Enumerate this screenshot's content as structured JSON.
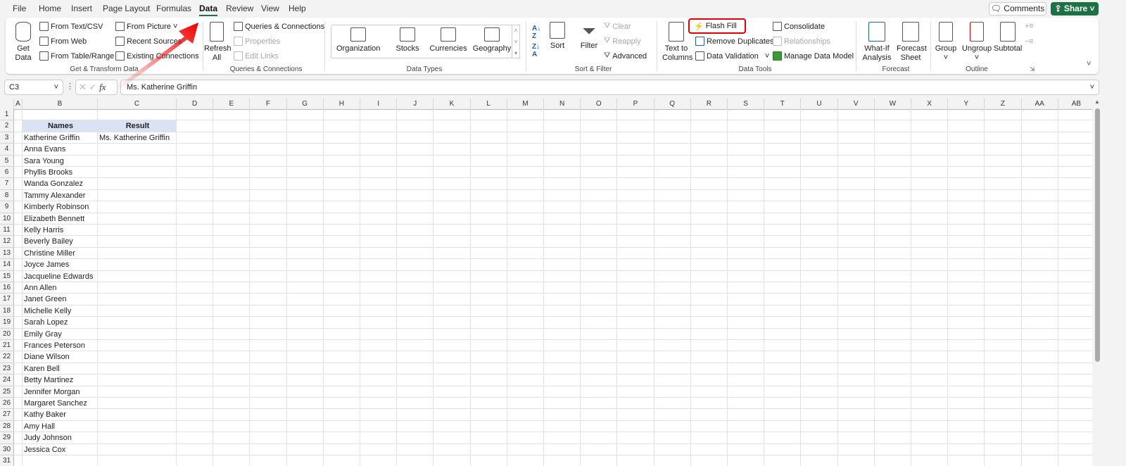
{
  "menu": {
    "tabs": [
      "File",
      "Home",
      "Insert",
      "Page Layout",
      "Formulas",
      "Data",
      "Review",
      "View",
      "Help"
    ],
    "active": "Data",
    "comments": "Comments",
    "share": "Share"
  },
  "ribbon": {
    "get_data": "Get Data",
    "get_transform": [
      "From Text/CSV",
      "From Web",
      "From Table/Range",
      "From Picture",
      "Recent Sources",
      "Existing Connections"
    ],
    "get_transform_label": "Get & Transform Data",
    "refresh": "Refresh All",
    "queries": [
      "Queries & Connections",
      "Properties",
      "Edit Links"
    ],
    "queries_label": "Queries & Connections",
    "data_types": [
      "Organization",
      "Stocks",
      "Currencies",
      "Geography"
    ],
    "data_types_label": "Data Types",
    "sort": "Sort",
    "filter": "Filter",
    "clear": "Clear",
    "reapply": "Reapply",
    "advanced": "Advanced",
    "sort_filter_label": "Sort & Filter",
    "text_to_columns": "Text to Columns",
    "tools": [
      "Flash Fill",
      "Remove Duplicates",
      "Data Validation",
      "Consolidate",
      "Relationships",
      "Manage Data Model"
    ],
    "data_tools_label": "Data Tools",
    "what_if": "What-If Analysis",
    "forecast_sheet": "Forecast Sheet",
    "forecast_label": "Forecast",
    "group": "Group",
    "ungroup": "Ungroup",
    "subtotal": "Subtotal",
    "outline_label": "Outline"
  },
  "formula_bar": {
    "name_box": "C3",
    "fx": "fx",
    "value": "Ms. Katherine Griffin"
  },
  "accent": "#1e7145",
  "highlight": "#e00000",
  "sheet": {
    "columns": [
      "A",
      "B",
      "C",
      "D",
      "E",
      "F",
      "G",
      "H",
      "I",
      "J",
      "K",
      "L",
      "M",
      "N",
      "O",
      "P",
      "Q",
      "R",
      "S",
      "T",
      "U",
      "V",
      "W",
      "X",
      "Y",
      "Z",
      "AA",
      "AB"
    ],
    "header_names": "Names",
    "header_result": "Result",
    "names": [
      "Katherine Griffin",
      "Anna Evans",
      "Sara Young",
      "Phyllis Brooks",
      "Wanda Gonzalez",
      "Tammy Alexander",
      "Kimberly Robinson",
      "Elizabeth Bennett",
      "Kelly Harris",
      "Beverly Bailey",
      "Christine Miller",
      "Joyce James",
      "Jacqueline Edwards",
      "Ann Allen",
      "Janet Green",
      "Michelle Kelly",
      "Sarah Lopez",
      "Emily Gray",
      "Frances Peterson",
      "Diane Wilson",
      "Karen Bell",
      "Betty Martinez",
      "Jennifer Morgan",
      "Margaret Sanchez",
      "Kathy Baker",
      "Amy Hall",
      "Judy Johnson",
      "Jessica Cox"
    ],
    "results": [
      "Ms. Katherine Griffin"
    ]
  }
}
